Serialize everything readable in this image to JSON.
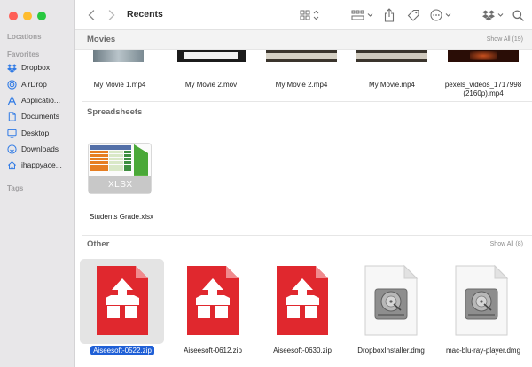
{
  "window": {
    "title": "Recents"
  },
  "sidebar": {
    "locations_label": "Locations",
    "favorites_label": "Favorites",
    "tags_label": "Tags",
    "items": [
      {
        "label": "Dropbox",
        "icon": "dropbox-icon"
      },
      {
        "label": "AirDrop",
        "icon": "airdrop-icon"
      },
      {
        "label": "Applicatio...",
        "icon": "applications-icon"
      },
      {
        "label": "Documents",
        "icon": "document-icon"
      },
      {
        "label": "Desktop",
        "icon": "desktop-icon"
      },
      {
        "label": "Downloads",
        "icon": "downloads-icon"
      },
      {
        "label": "ihappyace...",
        "icon": "home-icon"
      }
    ]
  },
  "sections": {
    "movies": {
      "title": "Movies",
      "show_all": "Show All (19)",
      "files": [
        {
          "name": "My Movie 1.mp4"
        },
        {
          "name": "My Movie 2.mov"
        },
        {
          "name": "My Movie 2.mp4"
        },
        {
          "name": "My Movie.mp4"
        },
        {
          "name_line1": "pexels_videos_1717998",
          "name_line2": "(2160p).mp4"
        }
      ]
    },
    "spreadsheets": {
      "title": "Spreadsheets",
      "files": [
        {
          "name": "Students Grade.xlsx",
          "badge": "XLSX"
        }
      ]
    },
    "other": {
      "title": "Other",
      "show_all": "Show All (8)",
      "files": [
        {
          "name": "Aiseesoft-0522.zip",
          "selected": true
        },
        {
          "name": "Aiseesoft-0612.zip"
        },
        {
          "name": "Aiseesoft-0630.zip"
        },
        {
          "name": "DropboxInstaller.dmg"
        },
        {
          "name": "mac-blu-ray-player.dmg"
        }
      ]
    }
  },
  "colors": {
    "accent": "#1f5fd6",
    "zip_red": "#e0282e",
    "sidebar_icon": "#2f7ae5",
    "dropbox_blue": "#0061fe"
  }
}
